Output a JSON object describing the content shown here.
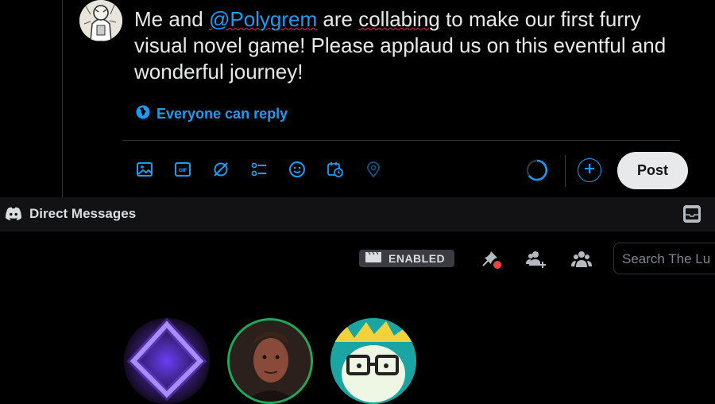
{
  "tweet": {
    "text_before": "Me and ",
    "mention": "@Polygrem",
    "text_mid1": " are ",
    "word_collabing": "collabing",
    "text_after": " to make our first furry visual novel game! Please applaud us on this eventful and wonderful journey!",
    "reply_setting": "Everyone can reply",
    "toolbar_icons": [
      "image-icon",
      "gif-icon",
      "grok-icon",
      "poll-icon",
      "emoji-icon",
      "schedule-icon",
      "location-icon"
    ],
    "post_label": "Post",
    "accent": "#1d9bf0"
  },
  "discord": {
    "window_title": "Direct Messages",
    "badge": "ENABLED",
    "search_placeholder": "Search The Lu",
    "header_icons": [
      "pin-icon",
      "add-friend-icon",
      "members-icon"
    ],
    "inbox_icon": "inbox-icon",
    "notification_dot": "#f23f43",
    "avatar_ring": "#23a55a"
  }
}
